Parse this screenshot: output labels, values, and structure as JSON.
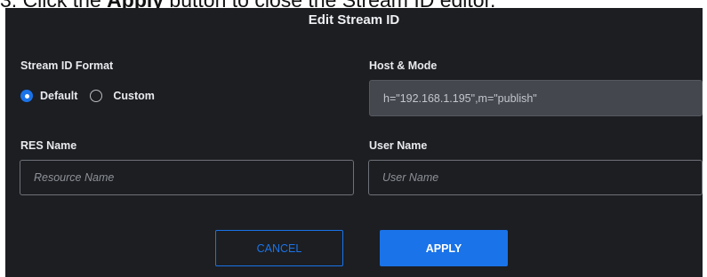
{
  "caption": {
    "prefix": "3. Click the ",
    "bold": "Apply",
    "suffix": " button to close the Stream ID editor."
  },
  "dialog": {
    "title": "Edit Stream ID",
    "stream_id_format": {
      "label": "Stream ID Format",
      "options": [
        {
          "label": "Default",
          "selected": true
        },
        {
          "label": "Custom",
          "selected": false
        }
      ]
    },
    "host_mode": {
      "label": "Host & Mode",
      "value": "h=\"192.168.1.195\",m=\"publish\""
    },
    "res_name": {
      "label": "RES Name",
      "placeholder": "Resource Name"
    },
    "user_name": {
      "label": "User Name",
      "placeholder": "User Name"
    },
    "buttons": {
      "cancel": "CANCEL",
      "apply": "APPLY"
    }
  },
  "colors": {
    "background": "#1c1e22",
    "accent": "#1a73e8"
  }
}
